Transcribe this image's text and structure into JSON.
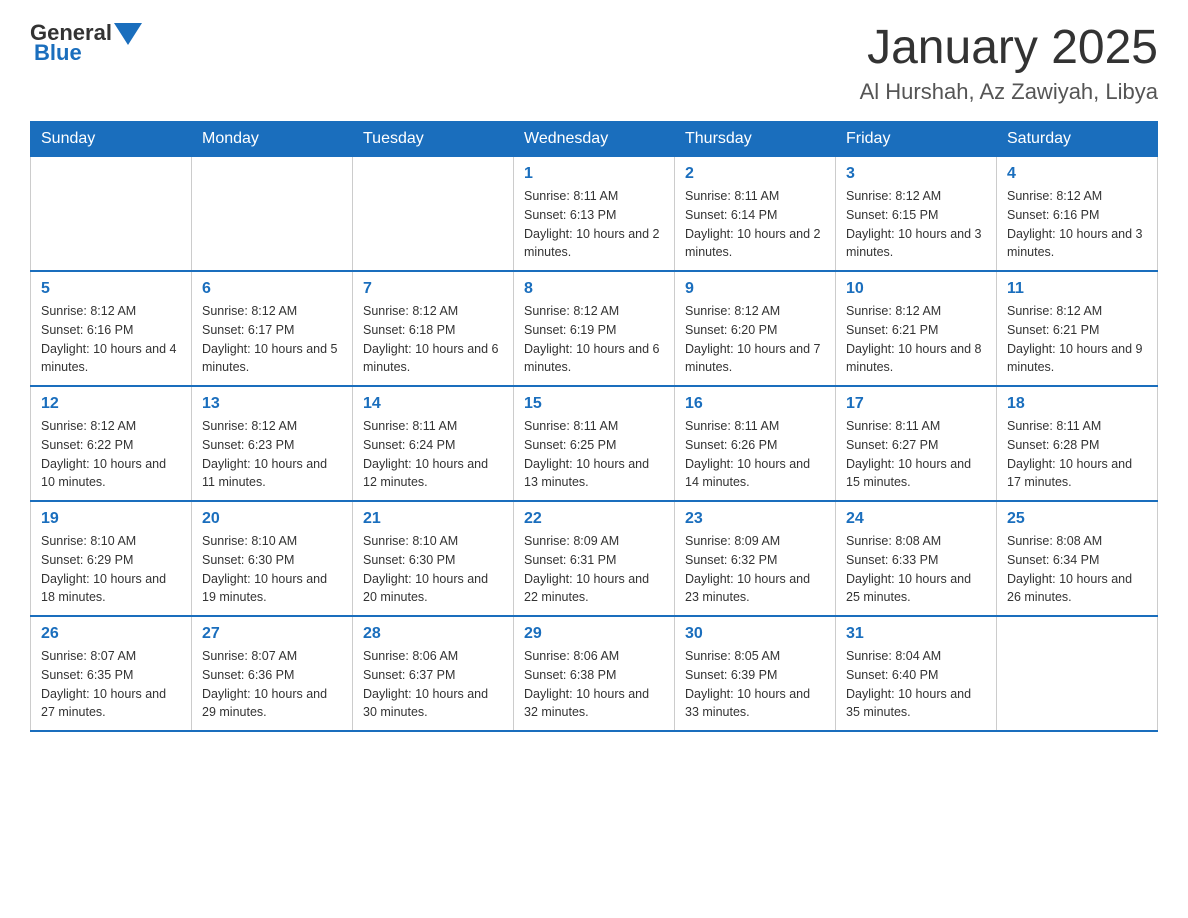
{
  "header": {
    "logo": {
      "text_general": "General",
      "text_blue": "Blue"
    },
    "title": "January 2025",
    "subtitle": "Al Hurshah, Az Zawiyah, Libya"
  },
  "days_of_week": [
    "Sunday",
    "Monday",
    "Tuesday",
    "Wednesday",
    "Thursday",
    "Friday",
    "Saturday"
  ],
  "weeks": [
    [
      {
        "day": "",
        "info": ""
      },
      {
        "day": "",
        "info": ""
      },
      {
        "day": "",
        "info": ""
      },
      {
        "day": "1",
        "info": "Sunrise: 8:11 AM\nSunset: 6:13 PM\nDaylight: 10 hours and 2 minutes."
      },
      {
        "day": "2",
        "info": "Sunrise: 8:11 AM\nSunset: 6:14 PM\nDaylight: 10 hours and 2 minutes."
      },
      {
        "day": "3",
        "info": "Sunrise: 8:12 AM\nSunset: 6:15 PM\nDaylight: 10 hours and 3 minutes."
      },
      {
        "day": "4",
        "info": "Sunrise: 8:12 AM\nSunset: 6:16 PM\nDaylight: 10 hours and 3 minutes."
      }
    ],
    [
      {
        "day": "5",
        "info": "Sunrise: 8:12 AM\nSunset: 6:16 PM\nDaylight: 10 hours and 4 minutes."
      },
      {
        "day": "6",
        "info": "Sunrise: 8:12 AM\nSunset: 6:17 PM\nDaylight: 10 hours and 5 minutes."
      },
      {
        "day": "7",
        "info": "Sunrise: 8:12 AM\nSunset: 6:18 PM\nDaylight: 10 hours and 6 minutes."
      },
      {
        "day": "8",
        "info": "Sunrise: 8:12 AM\nSunset: 6:19 PM\nDaylight: 10 hours and 6 minutes."
      },
      {
        "day": "9",
        "info": "Sunrise: 8:12 AM\nSunset: 6:20 PM\nDaylight: 10 hours and 7 minutes."
      },
      {
        "day": "10",
        "info": "Sunrise: 8:12 AM\nSunset: 6:21 PM\nDaylight: 10 hours and 8 minutes."
      },
      {
        "day": "11",
        "info": "Sunrise: 8:12 AM\nSunset: 6:21 PM\nDaylight: 10 hours and 9 minutes."
      }
    ],
    [
      {
        "day": "12",
        "info": "Sunrise: 8:12 AM\nSunset: 6:22 PM\nDaylight: 10 hours and 10 minutes."
      },
      {
        "day": "13",
        "info": "Sunrise: 8:12 AM\nSunset: 6:23 PM\nDaylight: 10 hours and 11 minutes."
      },
      {
        "day": "14",
        "info": "Sunrise: 8:11 AM\nSunset: 6:24 PM\nDaylight: 10 hours and 12 minutes."
      },
      {
        "day": "15",
        "info": "Sunrise: 8:11 AM\nSunset: 6:25 PM\nDaylight: 10 hours and 13 minutes."
      },
      {
        "day": "16",
        "info": "Sunrise: 8:11 AM\nSunset: 6:26 PM\nDaylight: 10 hours and 14 minutes."
      },
      {
        "day": "17",
        "info": "Sunrise: 8:11 AM\nSunset: 6:27 PM\nDaylight: 10 hours and 15 minutes."
      },
      {
        "day": "18",
        "info": "Sunrise: 8:11 AM\nSunset: 6:28 PM\nDaylight: 10 hours and 17 minutes."
      }
    ],
    [
      {
        "day": "19",
        "info": "Sunrise: 8:10 AM\nSunset: 6:29 PM\nDaylight: 10 hours and 18 minutes."
      },
      {
        "day": "20",
        "info": "Sunrise: 8:10 AM\nSunset: 6:30 PM\nDaylight: 10 hours and 19 minutes."
      },
      {
        "day": "21",
        "info": "Sunrise: 8:10 AM\nSunset: 6:30 PM\nDaylight: 10 hours and 20 minutes."
      },
      {
        "day": "22",
        "info": "Sunrise: 8:09 AM\nSunset: 6:31 PM\nDaylight: 10 hours and 22 minutes."
      },
      {
        "day": "23",
        "info": "Sunrise: 8:09 AM\nSunset: 6:32 PM\nDaylight: 10 hours and 23 minutes."
      },
      {
        "day": "24",
        "info": "Sunrise: 8:08 AM\nSunset: 6:33 PM\nDaylight: 10 hours and 25 minutes."
      },
      {
        "day": "25",
        "info": "Sunrise: 8:08 AM\nSunset: 6:34 PM\nDaylight: 10 hours and 26 minutes."
      }
    ],
    [
      {
        "day": "26",
        "info": "Sunrise: 8:07 AM\nSunset: 6:35 PM\nDaylight: 10 hours and 27 minutes."
      },
      {
        "day": "27",
        "info": "Sunrise: 8:07 AM\nSunset: 6:36 PM\nDaylight: 10 hours and 29 minutes."
      },
      {
        "day": "28",
        "info": "Sunrise: 8:06 AM\nSunset: 6:37 PM\nDaylight: 10 hours and 30 minutes."
      },
      {
        "day": "29",
        "info": "Sunrise: 8:06 AM\nSunset: 6:38 PM\nDaylight: 10 hours and 32 minutes."
      },
      {
        "day": "30",
        "info": "Sunrise: 8:05 AM\nSunset: 6:39 PM\nDaylight: 10 hours and 33 minutes."
      },
      {
        "day": "31",
        "info": "Sunrise: 8:04 AM\nSunset: 6:40 PM\nDaylight: 10 hours and 35 minutes."
      },
      {
        "day": "",
        "info": ""
      }
    ]
  ]
}
